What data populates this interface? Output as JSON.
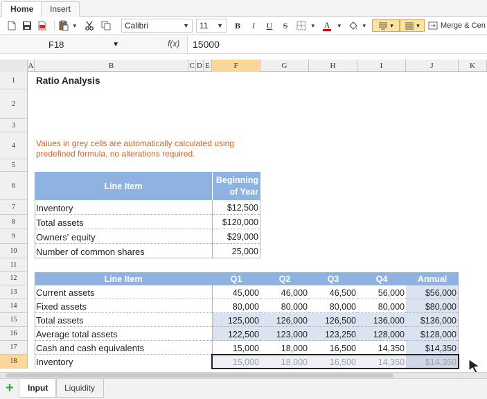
{
  "ribbon_tabs": [
    "Home",
    "Insert"
  ],
  "toolbar": {
    "font_name": "Calibri",
    "font_size": "11",
    "bold": "B",
    "italic": "I",
    "underline": "U",
    "strike": "S",
    "font_color_letter": "A",
    "merge_label": "Merge & Cen"
  },
  "formula_bar": {
    "cell_ref": "F18",
    "fx_label": "f(x)",
    "value": "15000"
  },
  "columns": [
    "A",
    "B",
    "C",
    "D",
    "E",
    "F",
    "G",
    "H",
    "I",
    "J",
    "K"
  ],
  "rows": [
    "1",
    "2",
    "3",
    "4",
    "5",
    "6",
    "7",
    "8",
    "9",
    "10",
    "11",
    "12",
    "13",
    "14",
    "15",
    "16",
    "17",
    "18"
  ],
  "selected": {
    "column": "F",
    "row": "18"
  },
  "sheet": {
    "title": "Ratio Analysis",
    "note_line1": "Values in grey cells are automatically calculated using",
    "note_line2": "predefined formula, no alterations required.",
    "table1": {
      "header_item": "Line Item",
      "header_boy_line1": "Beginning",
      "header_boy_line2": "of Year",
      "rows": [
        {
          "label": "Inventory",
          "value": "$12,500"
        },
        {
          "label": "Total assets",
          "value": "$120,000"
        },
        {
          "label": "Owners' equity",
          "value": "$29,000"
        },
        {
          "label": "Number of common shares",
          "value": "25,000"
        }
      ]
    },
    "table2": {
      "header_item": "Line Item",
      "headers": [
        "Q1",
        "Q2",
        "Q3",
        "Q4",
        "Annual"
      ],
      "rows": [
        {
          "label": "Current assets",
          "values": [
            "45,000",
            "46,000",
            "46,500",
            "56,000",
            "$56,000"
          ]
        },
        {
          "label": "Fixed assets",
          "values": [
            "80,000",
            "80,000",
            "80,000",
            "80,000",
            "$80,000"
          ]
        },
        {
          "label": "Total assets",
          "values": [
            "125,000",
            "126,000",
            "126,500",
            "136,000",
            "$136,000"
          ]
        },
        {
          "label": "Average total assets",
          "values": [
            "122,500",
            "123,000",
            "123,250",
            "128,000",
            "$128,000"
          ]
        },
        {
          "label": "Cash and cash equivalents",
          "values": [
            "15,000",
            "18,000",
            "16,500",
            "14,350",
            "$14,350"
          ]
        },
        {
          "label": "Inventory",
          "values": [
            "15,000",
            "18,000",
            "16,500",
            "14,350",
            "$14,350"
          ]
        }
      ]
    }
  },
  "sheet_tabs": [
    "Input",
    "Liquidity"
  ],
  "colors": {
    "header_blue": "#8fb3e0",
    "grey_cell": "#dbe3f1",
    "note_orange": "#d0632a",
    "selection_highlight": "#fbd89a"
  }
}
